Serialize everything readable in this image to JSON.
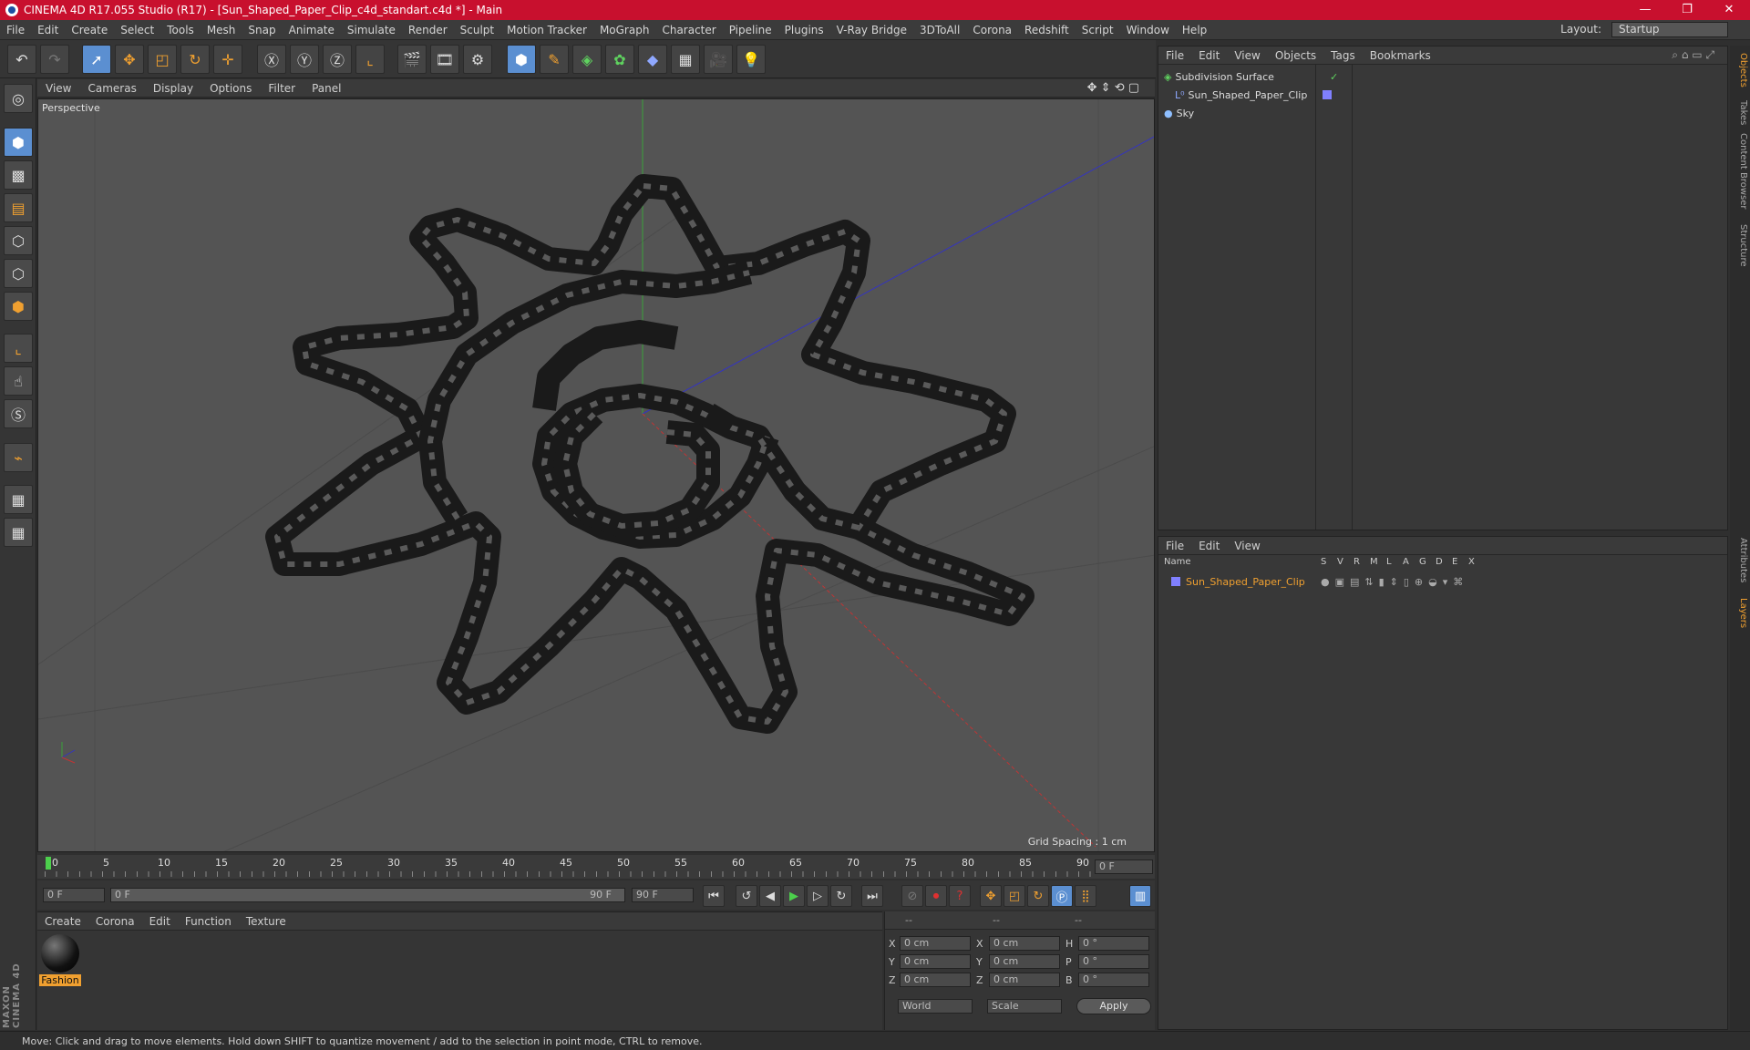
{
  "window": {
    "title": "CINEMA 4D R17.055 Studio (R17) - [Sun_Shaped_Paper_Clip_c4d_standart.c4d *] - Main",
    "minimize": "—",
    "maximize": "❐",
    "close": "✕"
  },
  "menubar": {
    "items": [
      "File",
      "Edit",
      "Create",
      "Select",
      "Tools",
      "Mesh",
      "Snap",
      "Animate",
      "Simulate",
      "Render",
      "Sculpt",
      "Motion Tracker",
      "MoGraph",
      "Character",
      "Pipeline",
      "Plugins",
      "V-Ray Bridge",
      "3DToAll",
      "Corona",
      "Redshift",
      "Script",
      "Window",
      "Help"
    ],
    "layout_label": "Layout:",
    "layout_value": "Startup"
  },
  "viewport": {
    "menu": [
      "View",
      "Cameras",
      "Display",
      "Options",
      "Filter",
      "Panel"
    ],
    "label": "Perspective",
    "grid_spacing": "Grid Spacing : 1 cm"
  },
  "timeline": {
    "ticks": [
      "0",
      "5",
      "10",
      "15",
      "20",
      "25",
      "30",
      "35",
      "40",
      "45",
      "50",
      "55",
      "60",
      "65",
      "70",
      "75",
      "80",
      "85",
      "90"
    ],
    "current_frame": "0 F"
  },
  "playback": {
    "start_field": "0 F",
    "range_start": "0 F",
    "range_end": "90 F",
    "end_field": "90 F"
  },
  "material_manager": {
    "menu": [
      "Create",
      "Corona",
      "Edit",
      "Function",
      "Texture"
    ],
    "material_name": "Fashion"
  },
  "attributes": {
    "header": [
      "--",
      "--",
      "--"
    ],
    "rows": [
      {
        "a": "X",
        "av": "0 cm",
        "b": "X",
        "bv": "0 cm",
        "c": "H",
        "cv": "0 °"
      },
      {
        "a": "Y",
        "av": "0 cm",
        "b": "Y",
        "bv": "0 cm",
        "c": "P",
        "cv": "0 °"
      },
      {
        "a": "Z",
        "av": "0 cm",
        "b": "Z",
        "bv": "0 cm",
        "c": "B",
        "cv": "0 °"
      }
    ],
    "coord_system": "World",
    "mode": "Scale",
    "apply": "Apply"
  },
  "object_manager": {
    "menu": [
      "File",
      "Edit",
      "View",
      "Objects",
      "Tags",
      "Bookmarks"
    ],
    "objects": [
      "Subdivision Surface",
      "Sun_Shaped_Paper_Clip",
      "Sky"
    ]
  },
  "layer_manager": {
    "menu": [
      "File",
      "Edit",
      "View"
    ],
    "columns": [
      "Name",
      "S",
      "V",
      "R",
      "M",
      "L",
      "A",
      "G",
      "D",
      "E",
      "X"
    ],
    "layer": "Sun_Shaped_Paper_Clip"
  },
  "side_tabs": [
    "Objects",
    "Takes",
    "Content Browser",
    "Structure",
    "Attributes",
    "Layers"
  ],
  "brand": "MAXON CINEMA 4D",
  "status": "Move: Click and drag to move elements. Hold down SHIFT to quantize movement / add to the selection in point mode, CTRL to remove.",
  "colors": {
    "title_bar": "#c8102e",
    "accent_blue": "#5b8fd1",
    "highlight": "#f0a030"
  }
}
